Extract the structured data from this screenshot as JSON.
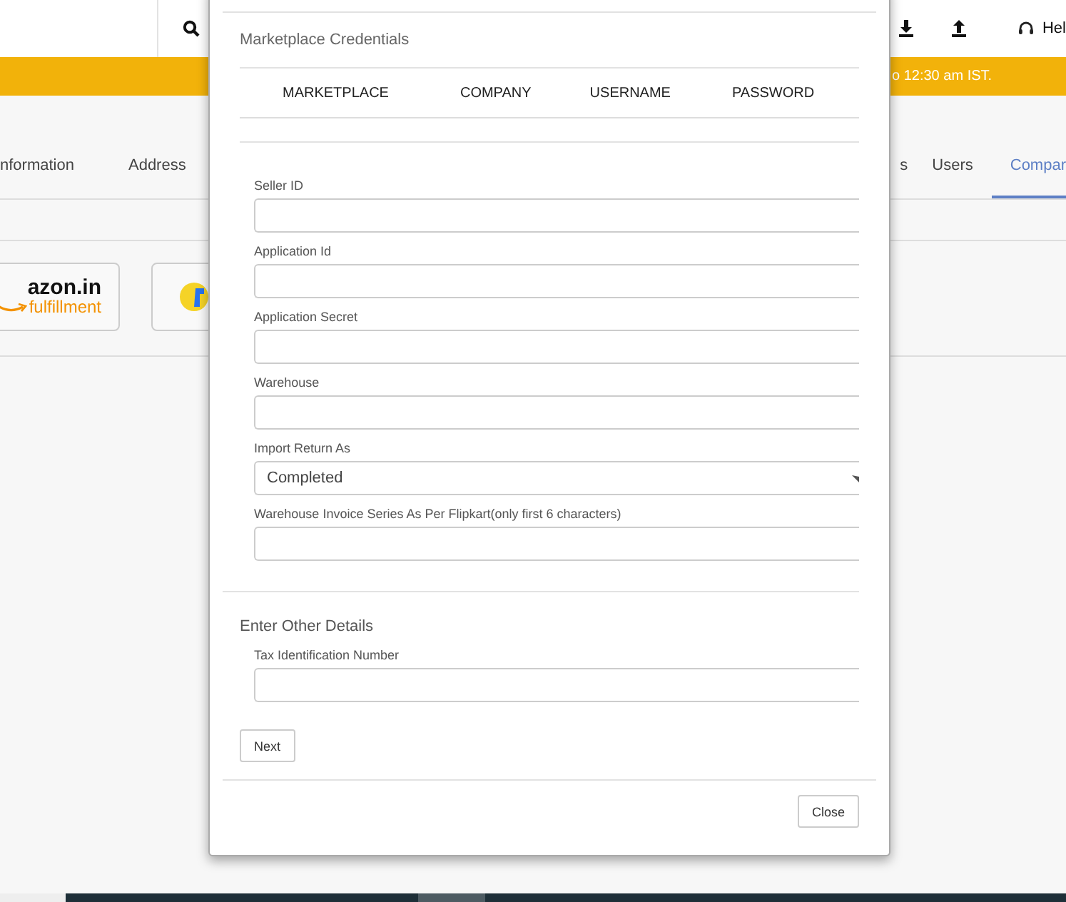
{
  "header": {
    "help": "Hel"
  },
  "banner": {
    "text": "o 12:30 am IST."
  },
  "tabs_left": [
    {
      "label": "nformation",
      "selected": false
    },
    {
      "label": "Address",
      "selected": false
    }
  ],
  "tabs_right": [
    {
      "label": "s",
      "selected": false
    },
    {
      "label": "Users",
      "selected": false
    },
    {
      "label": "Compar",
      "selected": true
    }
  ],
  "marketplaces": [
    {
      "kind": "amazon",
      "name": "azon.in",
      "sub": "fulfillment"
    },
    {
      "kind": "flipkart"
    }
  ],
  "modal": {
    "title": "Marketplace Credentials",
    "columns": [
      "MARKETPLACE",
      "COMPANY",
      "USERNAME",
      "PASSWORD"
    ],
    "fields": [
      {
        "kind": "text",
        "label": "Seller ID"
      },
      {
        "kind": "text",
        "label": "Application Id"
      },
      {
        "kind": "text",
        "label": "Application Secret"
      },
      {
        "kind": "text",
        "label": "Warehouse"
      },
      {
        "kind": "select",
        "label": "Import Return As",
        "value": "Completed"
      },
      {
        "kind": "text",
        "label": "Warehouse Invoice Series As Per Flipkart(only first 6 characters)"
      }
    ],
    "other_title": "Enter Other Details",
    "other_fields": [
      {
        "kind": "text",
        "label": "Tax Identification Number"
      }
    ],
    "next": "Next",
    "close": "Close"
  }
}
